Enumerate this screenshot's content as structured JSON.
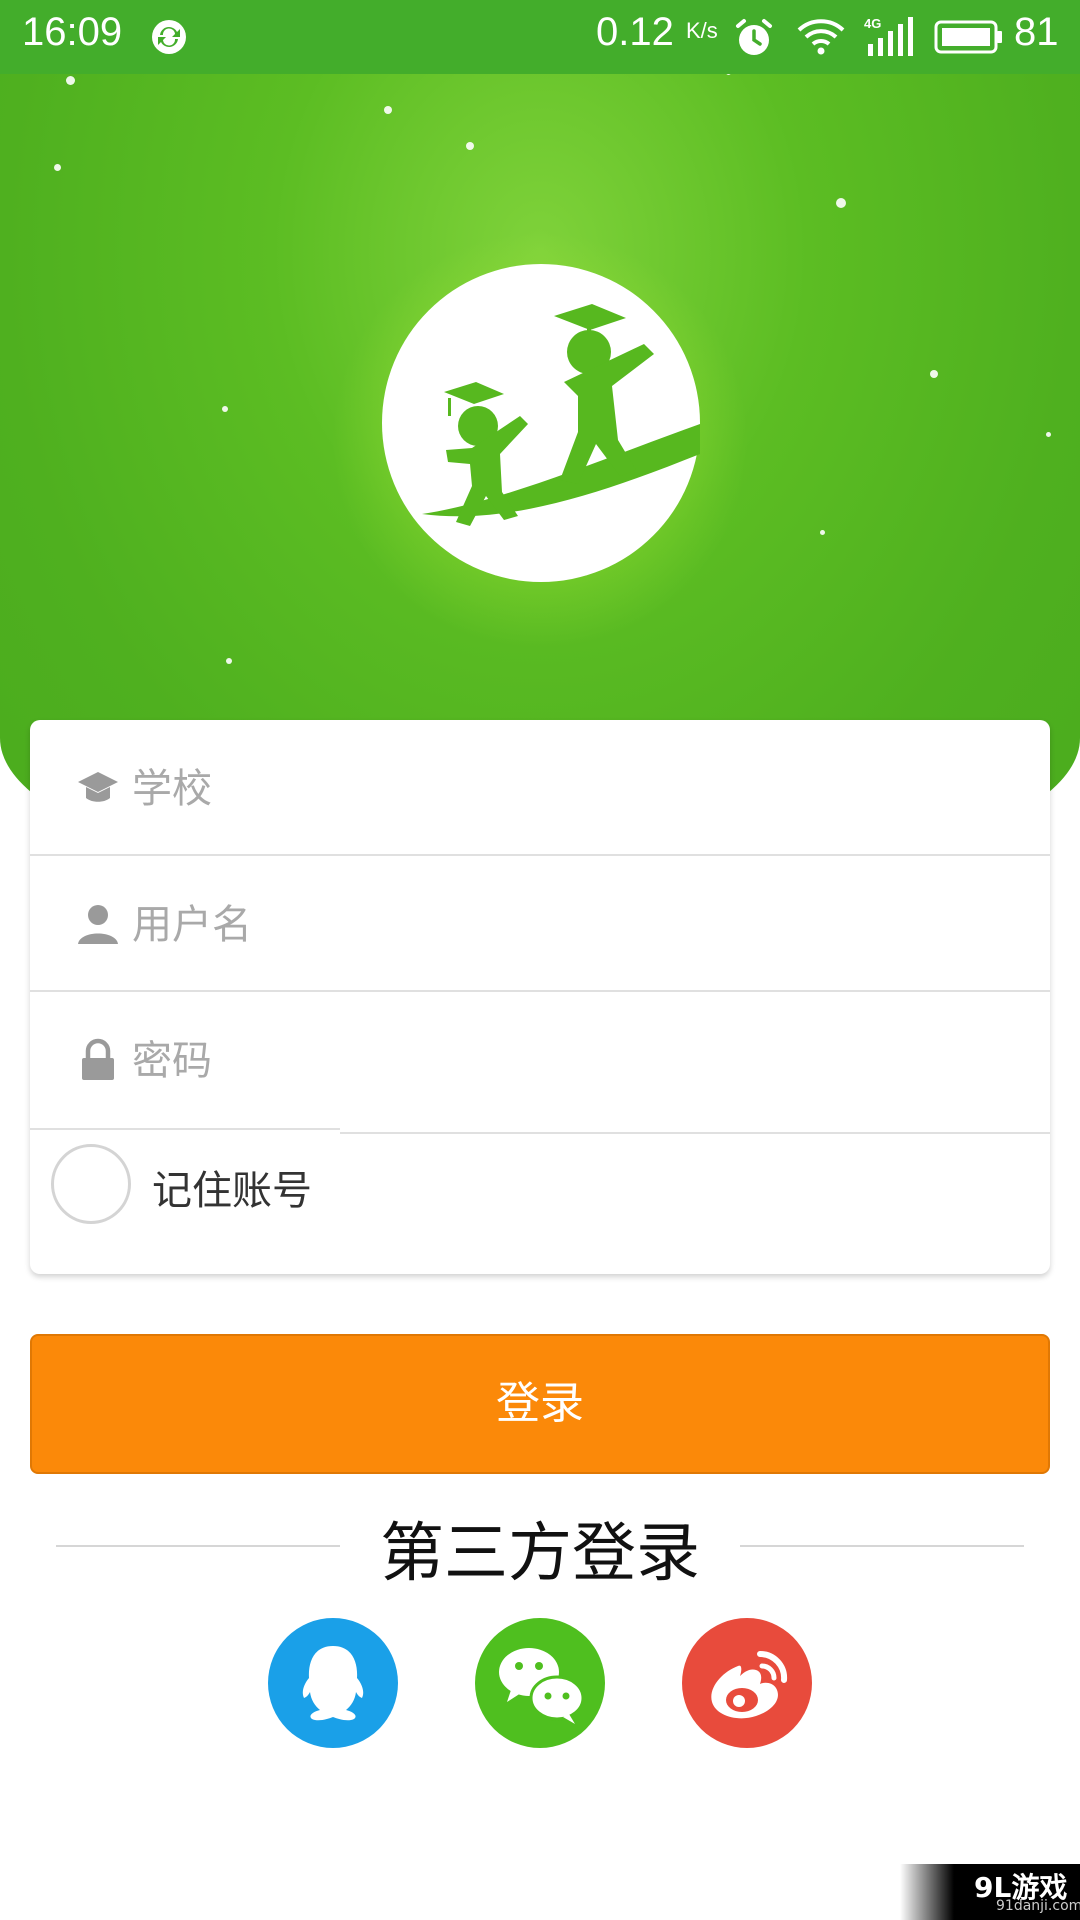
{
  "status_bar": {
    "time": "16:09",
    "speed": "0.12",
    "speed_unit": "K/s",
    "battery": "81"
  },
  "login_form": {
    "school_placeholder": "学校",
    "username_placeholder": "用户名",
    "password_placeholder": "密码",
    "remember_label": "记住账号",
    "login_button": "登录"
  },
  "third_party": {
    "title": "第三方登录",
    "providers": [
      "QQ",
      "WeChat",
      "Weibo"
    ]
  },
  "watermark": {
    "text": "9L游戏",
    "sub": "91danji.com"
  },
  "colors": {
    "primary_green": "#4fb01f",
    "status_green": "#43ad2b",
    "button_orange": "#fb8909",
    "qq_blue": "#1aa0e8",
    "wechat_green": "#4fbf1f",
    "weibo_red": "#e84b3c"
  }
}
